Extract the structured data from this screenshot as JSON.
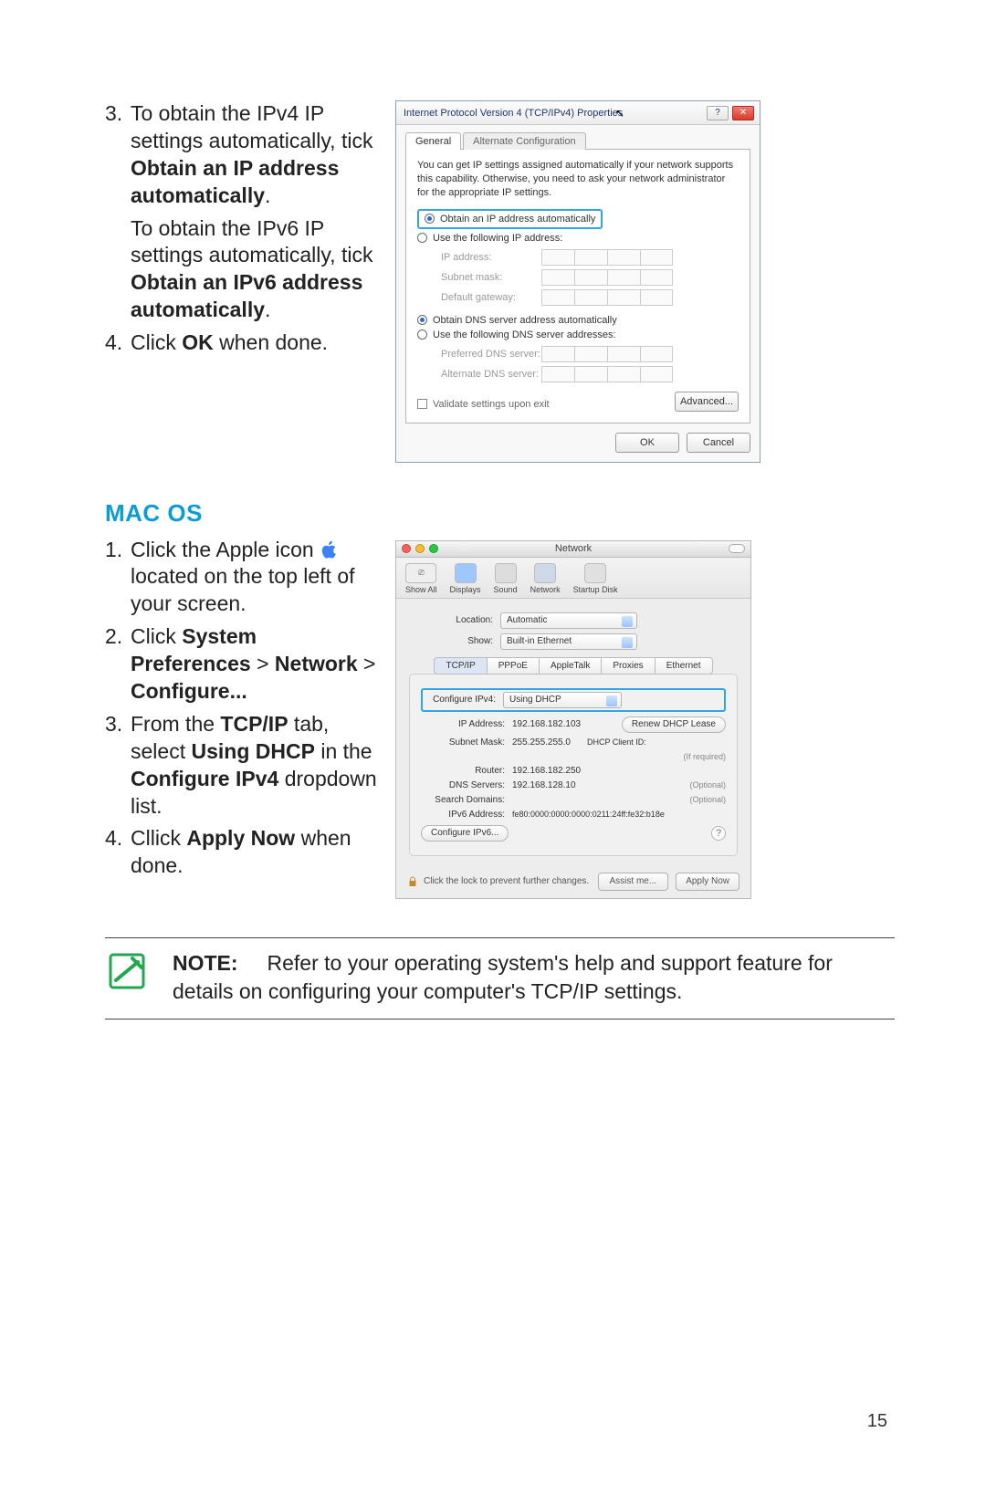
{
  "steps_win": {
    "s3_a": "To obtain the IPv4 IP settings automatically, tick ",
    "s3_b": "Obtain an IP address automatically",
    "s3_c": ".",
    "s3_d": "To obtain the IPv6 IP settings automatically, tick ",
    "s3_e": "Obtain an IPv6 address automatically",
    "s3_f": ".",
    "s4_a": "Click ",
    "s4_b": "OK",
    "s4_c": " when done."
  },
  "macos_heading": "MAC OS",
  "steps_mac": {
    "s1_a": "Click the Apple icon ",
    "s1_b": " located on the top left of your screen.",
    "s2_a": "Click ",
    "s2_b": "System Preferences",
    "s2_c": " > ",
    "s2_d": "Network",
    "s2_e": " > ",
    "s2_f": "Configure...",
    "s3_a": "From the ",
    "s3_b": "TCP/IP",
    "s3_c": " tab, select ",
    "s3_d": "Using DHCP",
    "s3_e": " in the ",
    "s3_f": "Configure IPv4",
    "s3_g": " dropdown list.",
    "s4_a": "Cllick ",
    "s4_b": "Apply Now",
    "s4_c": " when done."
  },
  "note": {
    "label": "NOTE:",
    "text": "Refer to your operating system's help and support feature for details on configuring your computer's TCP/IP settings."
  },
  "page_number": "15",
  "win": {
    "title": "Internet Protocol Version 4 (TCP/IPv4) Properties",
    "tab_general": "General",
    "tab_alt": "Alternate Configuration",
    "desc": "You can get IP settings assigned automatically if your network supports this capability. Otherwise, you need to ask your network administrator for the appropriate IP settings.",
    "r_auto_ip": "Obtain an IP address automatically",
    "r_use_ip": "Use the following IP address:",
    "f_ip": "IP address:",
    "f_mask": "Subnet mask:",
    "f_gw": "Default gateway:",
    "r_auto_dns": "Obtain DNS server address automatically",
    "r_use_dns": "Use the following DNS server addresses:",
    "f_pdns": "Preferred DNS server:",
    "f_adns": "Alternate DNS server:",
    "chk_validate": "Validate settings upon exit",
    "btn_adv": "Advanced...",
    "btn_ok": "OK",
    "btn_cancel": "Cancel",
    "help": "?",
    "close": "✕"
  },
  "mac": {
    "title": "Network",
    "tool_showall": "Show All",
    "tool_displays": "Displays",
    "tool_sound": "Sound",
    "tool_network": "Network",
    "tool_startup": "Startup Disk",
    "lbl_location": "Location:",
    "val_location": "Automatic",
    "lbl_show": "Show:",
    "val_show": "Built-in Ethernet",
    "tab_tcpip": "TCP/IP",
    "tab_pppoe": "PPPoE",
    "tab_appletalk": "AppleTalk",
    "tab_proxies": "Proxies",
    "tab_ethernet": "Ethernet",
    "lbl_cfgv4": "Configure IPv4:",
    "val_cfgv4": "Using DHCP",
    "lbl_ip": "IP Address:",
    "val_ip": "192.168.182.103",
    "btn_renew": "Renew DHCP Lease",
    "lbl_mask": "Subnet Mask:",
    "val_mask": "255.255.255.0",
    "lbl_client": "DHCP Client ID:",
    "hint_required": "(If required)",
    "lbl_router": "Router:",
    "val_router": "192.168.182.250",
    "lbl_dns": "DNS Servers:",
    "val_dns": "192.168.128.10",
    "hint_optional": "(Optional)",
    "lbl_search": "Search Domains:",
    "lbl_v6addr": "IPv6 Address:",
    "val_v6addr": "fe80:0000:0000:0000:0211:24ff:fe32:b18e",
    "btn_cfgv6": "Configure IPv6...",
    "lock_text": "Click the lock to prevent further changes.",
    "btn_assist": "Assist me...",
    "btn_apply": "Apply Now",
    "help": "?"
  }
}
